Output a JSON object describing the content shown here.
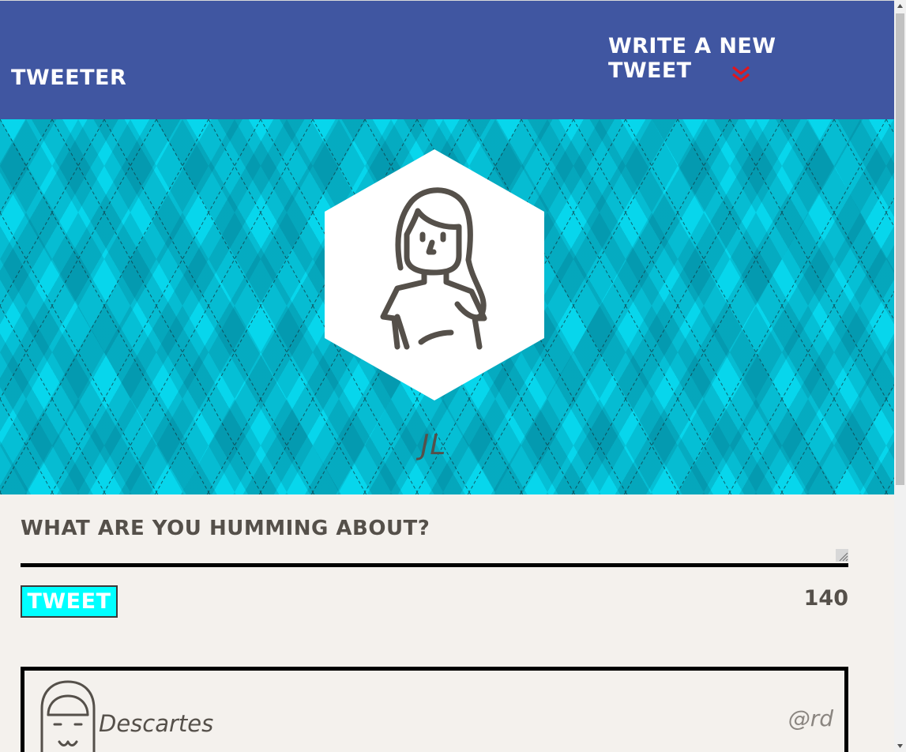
{
  "nav": {
    "brand": "Tweeter",
    "compose_link": "Write a new tweet",
    "chevron_icon": "double-chevron-down-icon",
    "colors": {
      "background": "#4056a1",
      "chevron": "#e3151b"
    }
  },
  "profile": {
    "avatar_icon": "girl-avatar-icon",
    "handle": "JL",
    "banner_color": "#07d6ec"
  },
  "compose": {
    "placeholder": "What are you humming about?",
    "value": "",
    "tweet_button": "Tweet",
    "char_counter": "140",
    "button_color": "#00ffff"
  },
  "tweets": [
    {
      "avatar_icon": "girl-bangs-avatar-icon",
      "name": "Descartes",
      "handle": "@rd"
    }
  ]
}
